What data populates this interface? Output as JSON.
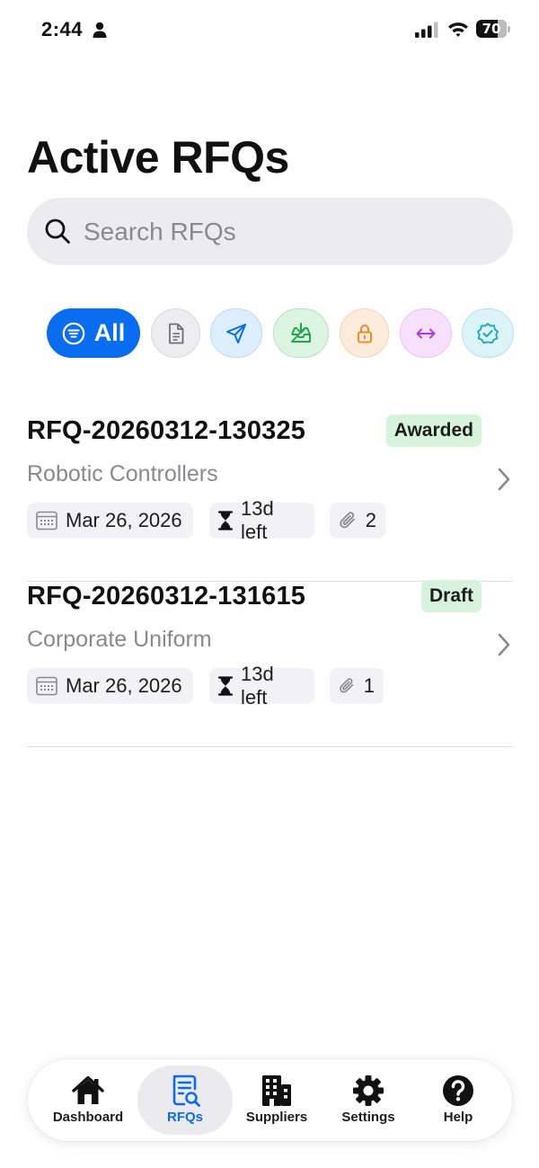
{
  "status_bar": {
    "time": "2:44",
    "battery": "70"
  },
  "page": {
    "title": "Active RFQs"
  },
  "search": {
    "placeholder": "Search RFQs",
    "value": ""
  },
  "filters": {
    "all_label": "All",
    "items": [
      {
        "name": "all",
        "icon": "filter-lines-icon",
        "selected": true,
        "color": "#0a6cf0"
      },
      {
        "name": "draft",
        "icon": "document-icon",
        "color": "#6e6e73"
      },
      {
        "name": "sent",
        "icon": "paper-plane-icon",
        "color": "#0a6cf0"
      },
      {
        "name": "received",
        "icon": "inbox-download-icon",
        "color": "#1fa84a"
      },
      {
        "name": "locked",
        "icon": "lock-icon",
        "color": "#f08a24"
      },
      {
        "name": "negotiation",
        "icon": "arrows-left-right-icon",
        "color": "#b33bd6"
      },
      {
        "name": "awarded",
        "icon": "verified-badge-icon",
        "color": "#12a7c4"
      }
    ]
  },
  "rfqs": [
    {
      "id": "RFQ-20260312-130325",
      "status": "Awarded",
      "name": "Robotic Controllers",
      "due_date": "Mar 26, 2026",
      "time_left": "13d left",
      "attachments": "2"
    },
    {
      "id": "RFQ-20260312-131615",
      "status": "Draft",
      "name": "Corporate Uniform",
      "due_date": "Mar 26, 2026",
      "time_left": "13d left",
      "attachments": "1"
    }
  ],
  "tab_bar": {
    "active": "RFQs",
    "accent_color": "#0a6cf0",
    "tabs": [
      {
        "label": "Dashboard",
        "icon": "house-icon"
      },
      {
        "label": "RFQs",
        "icon": "document-search-icon"
      },
      {
        "label": "Suppliers",
        "icon": "building-icon"
      },
      {
        "label": "Settings",
        "icon": "gear-icon"
      },
      {
        "label": "Help",
        "icon": "question-circle-icon"
      }
    ]
  }
}
